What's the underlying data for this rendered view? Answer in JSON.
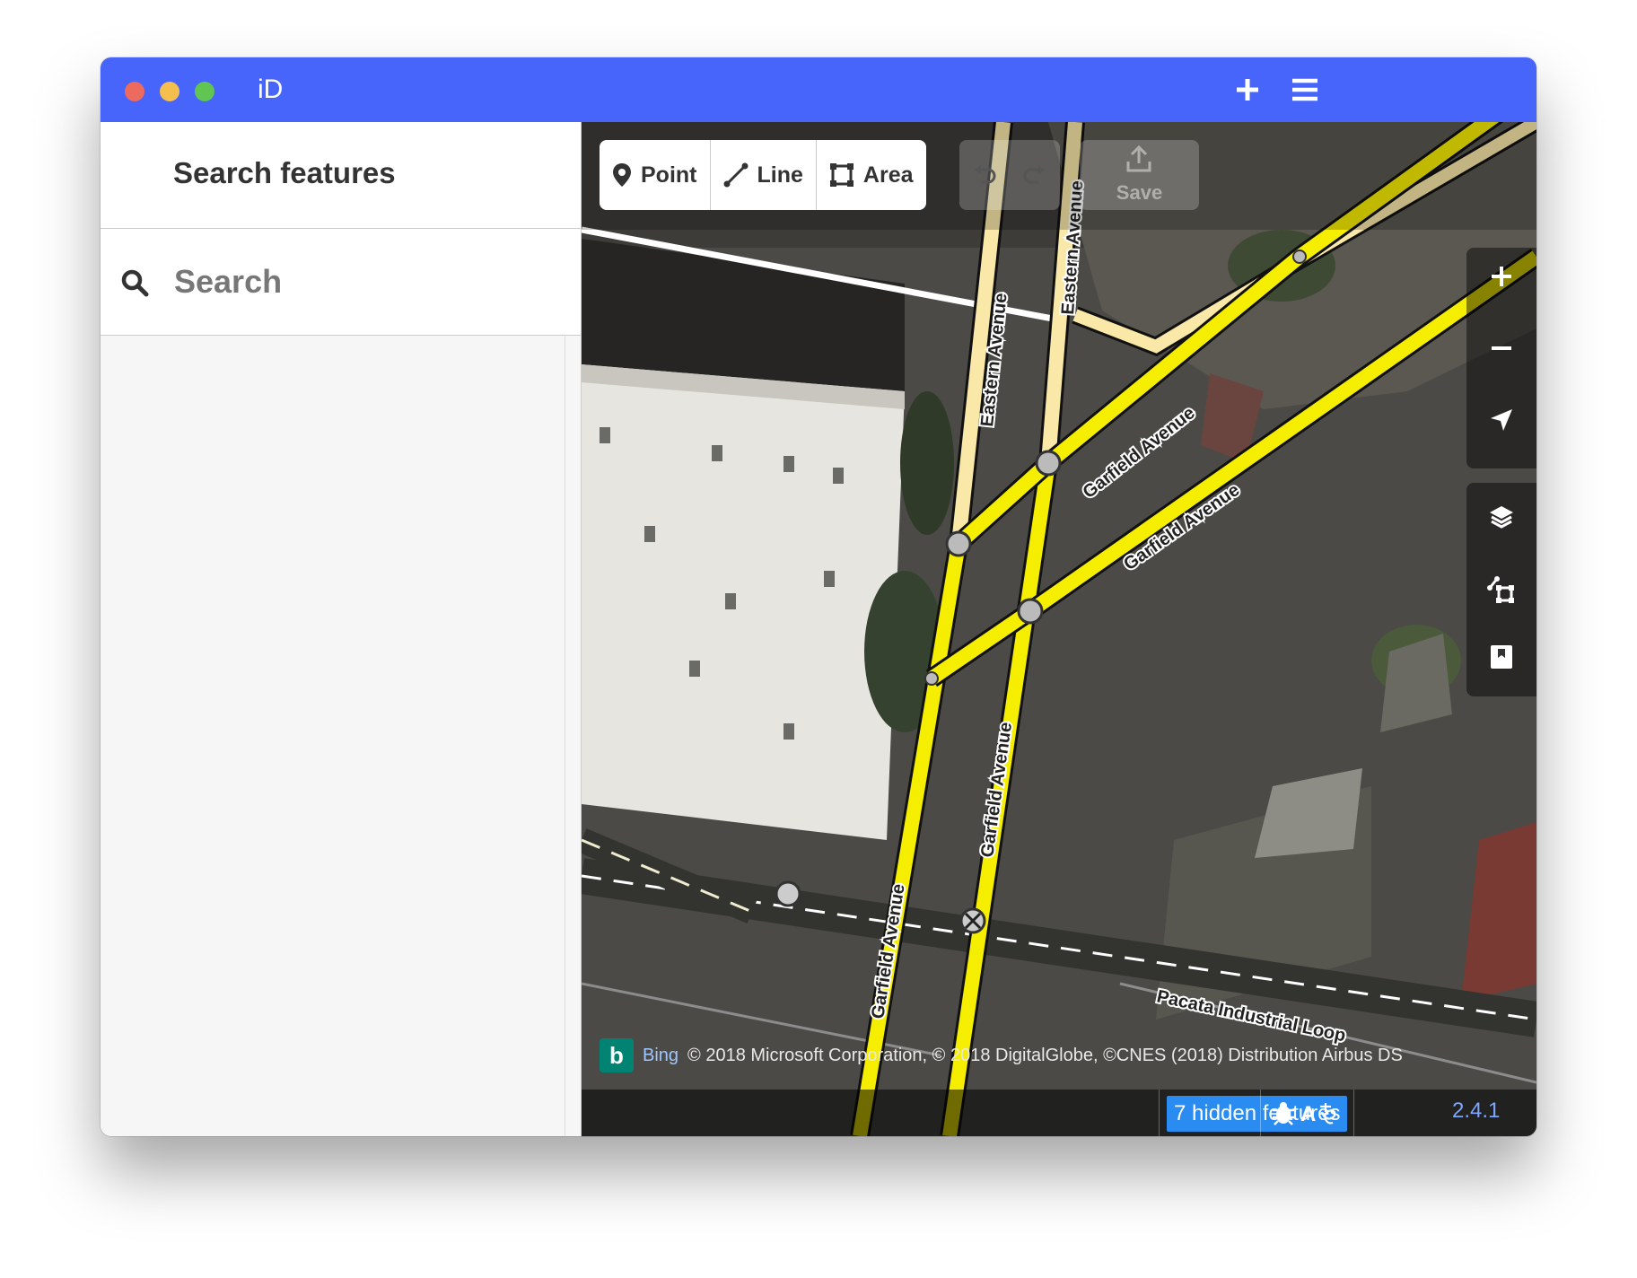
{
  "window": {
    "title": "iD"
  },
  "sidebar": {
    "header": "Search features",
    "search_placeholder": "Search"
  },
  "toolbar": {
    "modes": [
      {
        "label": "Point",
        "icon": "point-icon"
      },
      {
        "label": "Line",
        "icon": "line-icon"
      },
      {
        "label": "Area",
        "icon": "area-icon"
      }
    ],
    "save_label": "Save"
  },
  "map": {
    "street_labels": [
      "Eastern Avenue",
      "Eastern Avenue",
      "Garfield Avenue",
      "Garfield Avenue",
      "Garfield Avenue",
      "Garfield Avenue",
      "Pacata Industrial Loop"
    ],
    "imagery_provider": "Bing",
    "attribution": "© 2018 Microsoft Corporation, © 2018 DigitalGlobe, ©CNES (2018) Distribution Airbus DS"
  },
  "footer": {
    "hidden_features": "7 hidden features",
    "version": "2.4.1"
  },
  "colors": {
    "titlebar": "#4765fa",
    "road_primary": "#f6ee00",
    "road_light": "#f9e8a8",
    "hidden_features_bg": "#2a8cf0"
  }
}
